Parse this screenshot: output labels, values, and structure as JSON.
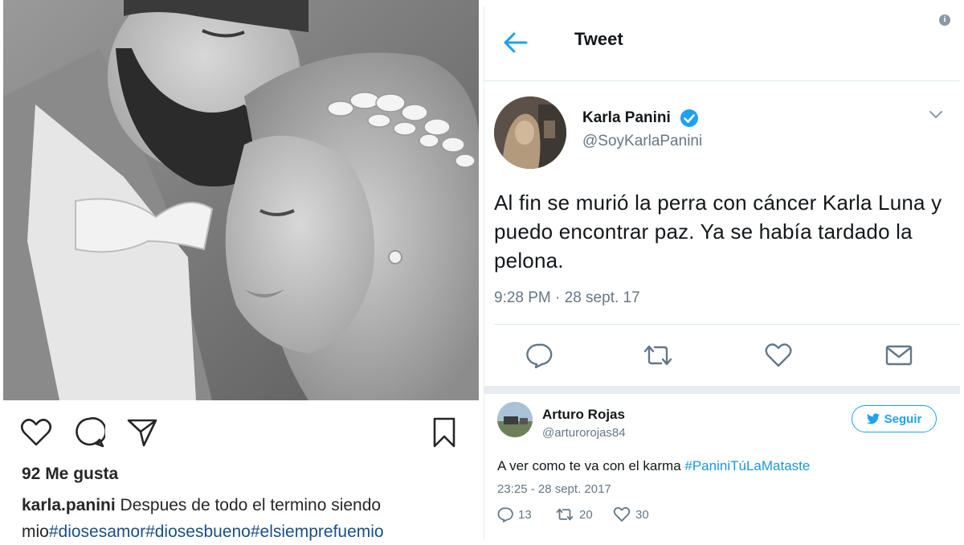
{
  "instagram": {
    "likes": "92 Me gusta",
    "username": "karla.panini",
    "caption_text": " Despues de todo el termino siendo mio",
    "hashtags": [
      "#diosesamor",
      "#diosesbueno",
      "#elsiemprefuemio"
    ],
    "icons": [
      "heart-icon",
      "comment-icon",
      "share-icon",
      "bookmark-icon"
    ]
  },
  "tweet": {
    "header_title": "Tweet",
    "author_name": "Karla Panini",
    "author_handle": "@SoyKarlaPanini",
    "text": "Al fin se murió la perra con cáncer Karla Luna y puedo encontrar paz. Ya se había tardado la pelona.",
    "timestamp": "9:28 PM · 28 sept. 17",
    "icons": [
      "back-arrow-icon",
      "verified-icon",
      "chevron-down-icon",
      "reply-icon",
      "retweet-icon",
      "like-icon",
      "message-icon"
    ]
  },
  "reply": {
    "author_name": "Arturo Rojas",
    "author_handle": "@arturorojas84",
    "follow_label": "Seguir",
    "text": "A ver como te va con el karma ",
    "hashtag": "#PaniniTúLaMataste",
    "timestamp": "23:25 - 28 sept. 2017",
    "replies": "13",
    "retweets": "20",
    "likes": "30"
  },
  "colors": {
    "twitter_blue": "#1da1f2",
    "hashtag_blue": "#1b95e0",
    "instagram_tag": "#1a4f86",
    "gray_text": "#657786"
  }
}
